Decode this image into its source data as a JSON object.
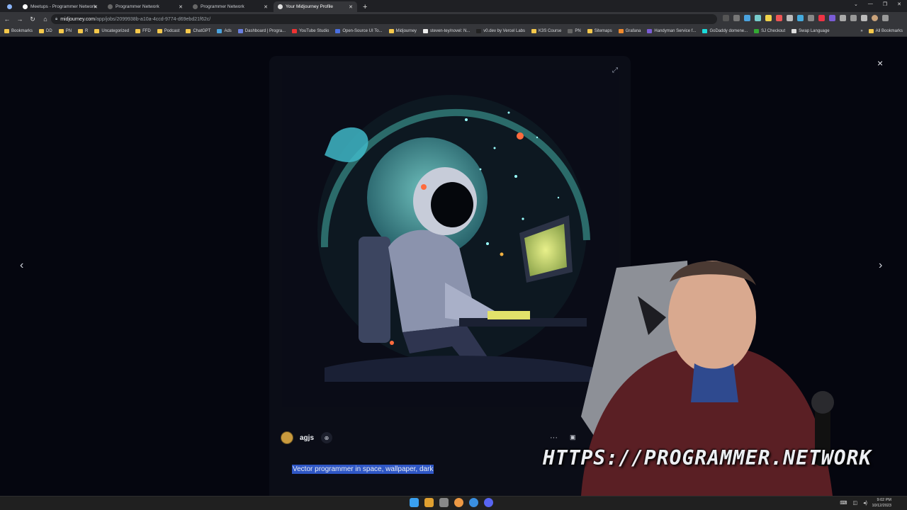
{
  "browser": {
    "tabs": [
      {
        "label": "",
        "active": false
      },
      {
        "label": "Meetups - Programmer Network",
        "active": false
      },
      {
        "label": "Programmer Network",
        "active": false
      },
      {
        "label": "Programmer Network",
        "active": false
      },
      {
        "label": "Your Midjourney Profile",
        "active": true
      }
    ],
    "new_tab": "+",
    "url_host": "midjourney.com",
    "url_path": "/app/jobs/2099938b-a10a-4ccd-9774-d69ebd21f62c/",
    "bookmarks": [
      "Bookmarks",
      "DD",
      "PN",
      "R",
      "Uncategorized",
      "FFD",
      "Podcast",
      "ChatGPT",
      "Ads",
      "Dashboard | Progra...",
      "YouTube Studio",
      "Open-Source UI To...",
      "Midjourney",
      "steven-tey/novel: N...",
      "v0.dev by Vercel Labs",
      "K3S Course",
      "PN",
      "Sitemaps",
      "Grafana",
      "Handyman Service f...",
      "GoDaddy domene...",
      "SJ Checkout",
      "Swap Language"
    ],
    "all_bookmarks": "All Bookmarks"
  },
  "viewer": {
    "close_glyph": "×",
    "prev_glyph": "‹",
    "next_glyph": "›",
    "expand_glyph": "⤢",
    "author": {
      "username": "agjs"
    },
    "more_glyph": "···",
    "prompt": "Vector programmer in space, wallpaper, dark"
  },
  "overlay": {
    "watermark": "HTTPS://PROGRAMMER.NETWORK"
  },
  "taskbar": {
    "time": "9:02 PM",
    "date": "10/12/2023"
  },
  "colors": {
    "background": "#05060f",
    "selection": "#2f57c6",
    "planet": "#3f8f8f",
    "screen": "#c9d46a"
  }
}
